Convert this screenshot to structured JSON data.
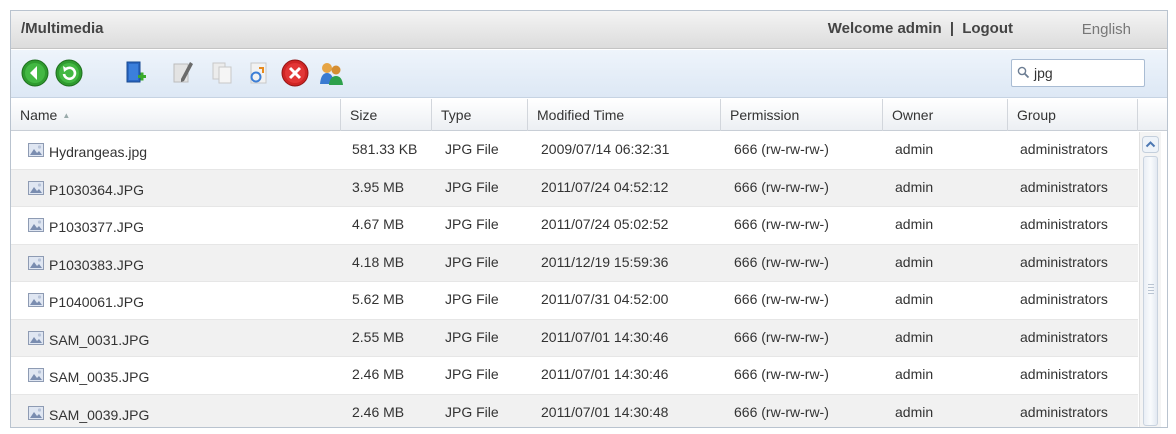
{
  "header": {
    "path": "/Multimedia",
    "welcome": "Welcome admin",
    "separator": "|",
    "logout": "Logout",
    "language": "English"
  },
  "toolbar": {
    "buttons": [
      {
        "name": "back-icon"
      },
      {
        "name": "refresh-icon"
      },
      {
        "name": "new-folder-icon"
      },
      {
        "name": "rename-icon"
      },
      {
        "name": "copy-icon"
      },
      {
        "name": "upload-icon"
      },
      {
        "name": "delete-icon"
      },
      {
        "name": "share-icon"
      }
    ],
    "search": {
      "value": "jpg"
    }
  },
  "columns": {
    "name": "Name",
    "size": "Size",
    "type": "Type",
    "modified": "Modified Time",
    "permission": "Permission",
    "owner": "Owner",
    "group": "Group"
  },
  "files": [
    {
      "name": "Hydrangeas.jpg",
      "size": "581.33 KB",
      "type": "JPG File",
      "modified": "2009/07/14 06:32:31",
      "permission": "666 (rw-rw-rw-)",
      "owner": "admin",
      "group": "administrators"
    },
    {
      "name": "P1030364.JPG",
      "size": "3.95 MB",
      "type": "JPG File",
      "modified": "2011/07/24 04:52:12",
      "permission": "666 (rw-rw-rw-)",
      "owner": "admin",
      "group": "administrators"
    },
    {
      "name": "P1030377.JPG",
      "size": "4.67 MB",
      "type": "JPG File",
      "modified": "2011/07/24 05:02:52",
      "permission": "666 (rw-rw-rw-)",
      "owner": "admin",
      "group": "administrators"
    },
    {
      "name": "P1030383.JPG",
      "size": "4.18 MB",
      "type": "JPG File",
      "modified": "2011/12/19 15:59:36",
      "permission": "666 (rw-rw-rw-)",
      "owner": "admin",
      "group": "administrators"
    },
    {
      "name": "P1040061.JPG",
      "size": "5.62 MB",
      "type": "JPG File",
      "modified": "2011/07/31 04:52:00",
      "permission": "666 (rw-rw-rw-)",
      "owner": "admin",
      "group": "administrators"
    },
    {
      "name": "SAM_0031.JPG",
      "size": "2.55 MB",
      "type": "JPG File",
      "modified": "2011/07/01 14:30:46",
      "permission": "666 (rw-rw-rw-)",
      "owner": "admin",
      "group": "administrators"
    },
    {
      "name": "SAM_0035.JPG",
      "size": "2.46 MB",
      "type": "JPG File",
      "modified": "2011/07/01 14:30:46",
      "permission": "666 (rw-rw-rw-)",
      "owner": "admin",
      "group": "administrators"
    },
    {
      "name": "SAM_0039.JPG",
      "size": "2.46 MB",
      "type": "JPG File",
      "modified": "2011/07/01 14:30:48",
      "permission": "666 (rw-rw-rw-)",
      "owner": "admin",
      "group": "administrators"
    }
  ]
}
